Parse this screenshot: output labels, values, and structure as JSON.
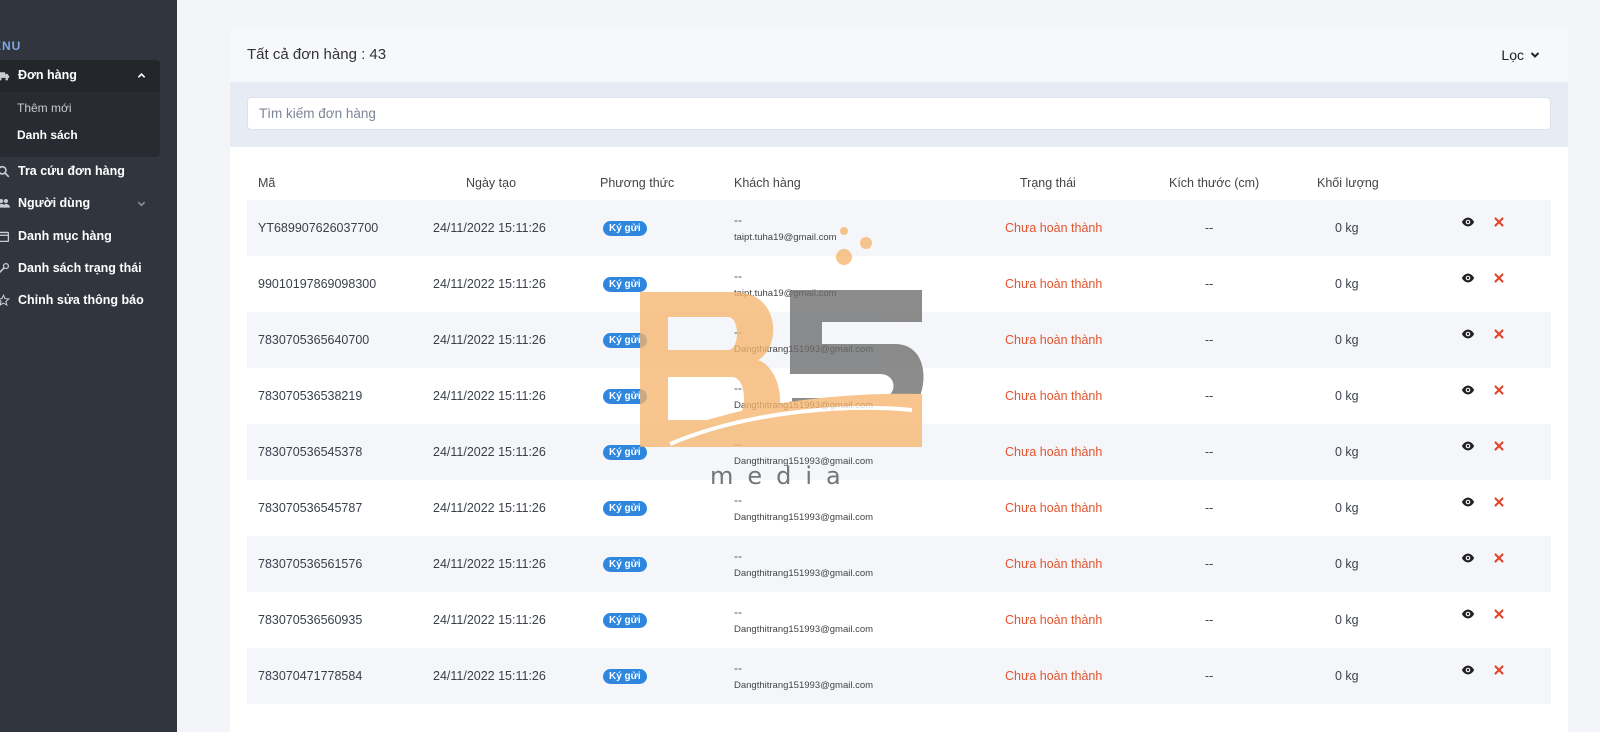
{
  "sidebar": {
    "menu_label": "ENU",
    "groups": [
      {
        "label": "Đơn hàng",
        "icon": "truck-icon",
        "expanded": true,
        "children": [
          {
            "label": "Thêm mới",
            "active": false
          },
          {
            "label": "Danh sách",
            "active": true
          }
        ]
      }
    ],
    "items": [
      {
        "label": "Tra cứu đơn hàng",
        "icon": "search-icon"
      },
      {
        "label": "Người dùng",
        "icon": "users-icon",
        "has_children": true
      },
      {
        "label": "Danh mục hàng",
        "icon": "calendar-icon"
      },
      {
        "label": "Danh sách trạng thái",
        "icon": "wrench-icon"
      },
      {
        "label": "Chỉnh sửa thông báo",
        "icon": "star-icon"
      }
    ]
  },
  "orders": {
    "title": "Tất cả đơn hàng : 43",
    "filter_label": "Lọc",
    "search_placeholder": "Tìm kiếm đơn hàng",
    "columns": [
      "Mã",
      "Ngày tạo",
      "Phương thức",
      "Khách hàng",
      "Trạng thái",
      "Kích thước (cm)",
      "Khối lượng"
    ],
    "rows": [
      {
        "code": "YT689907626037700",
        "created": "24/11/2022 15:11:26",
        "method": "Ký gửi",
        "customer_name": "--",
        "customer_email": "taipt.tuha19@gmail.com",
        "status": "Chưa hoàn thành",
        "size": "--",
        "weight": "0 kg"
      },
      {
        "code": "99010197869098300",
        "created": "24/11/2022 15:11:26",
        "method": "Ký gửi",
        "customer_name": "--",
        "customer_email": "taipt.tuha19@gmail.com",
        "status": "Chưa hoàn thành",
        "size": "--",
        "weight": "0 kg"
      },
      {
        "code": "7830705365640700",
        "created": "24/11/2022 15:11:26",
        "method": "Ký gửi",
        "customer_name": "--",
        "customer_email": "Dangthitrang151993@gmail.com",
        "status": "Chưa hoàn thành",
        "size": "--",
        "weight": "0 kg"
      },
      {
        "code": "783070536538219",
        "created": "24/11/2022 15:11:26",
        "method": "Ký gửi",
        "customer_name": "--",
        "customer_email": "Dangthitrang151993@gmail.com",
        "status": "Chưa hoàn thành",
        "size": "--",
        "weight": "0 kg"
      },
      {
        "code": "783070536545378",
        "created": "24/11/2022 15:11:26",
        "method": "Ký gửi",
        "customer_name": "--",
        "customer_email": "Dangthitrang151993@gmail.com",
        "status": "Chưa hoàn thành",
        "size": "--",
        "weight": "0 kg"
      },
      {
        "code": "783070536545787",
        "created": "24/11/2022 15:11:26",
        "method": "Ký gửi",
        "customer_name": "--",
        "customer_email": "Dangthitrang151993@gmail.com",
        "status": "Chưa hoàn thành",
        "size": "--",
        "weight": "0 kg"
      },
      {
        "code": "783070536561576",
        "created": "24/11/2022 15:11:26",
        "method": "Ký gửi",
        "customer_name": "--",
        "customer_email": "Dangthitrang151993@gmail.com",
        "status": "Chưa hoàn thành",
        "size": "--",
        "weight": "0 kg"
      },
      {
        "code": "783070536560935",
        "created": "24/11/2022 15:11:26",
        "method": "Ký gửi",
        "customer_name": "--",
        "customer_email": "Dangthitrang151993@gmail.com",
        "status": "Chưa hoàn thành",
        "size": "--",
        "weight": "0 kg"
      },
      {
        "code": "783070471778584",
        "created": "24/11/2022 15:11:26",
        "method": "Ký gửi",
        "customer_name": "--",
        "customer_email": "Dangthitrang151993@gmail.com",
        "status": "Chưa hoàn thành",
        "size": "--",
        "weight": "0 kg"
      }
    ],
    "row_actions": [
      "eye-icon",
      "delete-x-icon"
    ]
  },
  "watermark": {
    "brand": "B5",
    "tagline": "media"
  },
  "colors": {
    "sidebar_bg": "#31353d",
    "badge": "#2f86df",
    "status_text": "#e0552e",
    "delete_icon": "#e0452a",
    "watermark_orange": "#f6b56e",
    "watermark_gray": "#6c6c6c"
  }
}
